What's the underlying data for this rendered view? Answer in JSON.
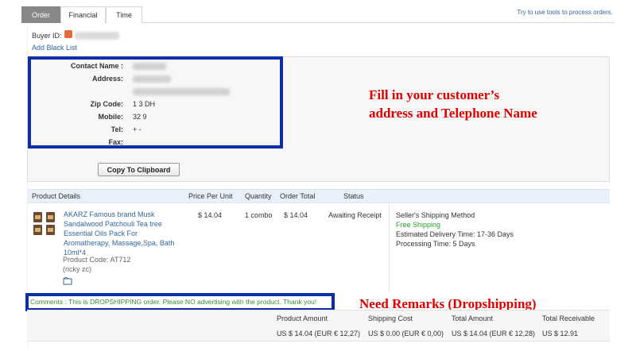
{
  "tabs": [
    {
      "label": "Order",
      "active": true
    },
    {
      "label": "Financial",
      "active": false
    },
    {
      "label": "Time",
      "active": false
    }
  ],
  "tools_link": "Try to use tools to process orders.",
  "buyer": {
    "id_label": "Buyer ID:",
    "add_black_list": "Add Black List"
  },
  "address": {
    "contact_name_label": "Contact Name :",
    "address_label": "Address:",
    "zip_label": "Zip Code:",
    "zip_value": "1 3 DH",
    "mobile_label": "Mobile:",
    "mobile_value": "32 9",
    "tel_label": "Tel:",
    "tel_value": "+ -",
    "fax_label": "Fax:",
    "copy_button": "Copy To Clipboard"
  },
  "annotations": {
    "address_line1": "Fill in your customer’s",
    "address_line2": "address and Telephone Name",
    "remarks": "Need Remarks (Dropshipping)"
  },
  "products": {
    "headers": {
      "details": "Product Details",
      "price": "Price Per Unit",
      "quantity": "Quantity",
      "total": "Order Total",
      "status": "Status"
    },
    "item": {
      "title": "AKARZ Famous brand Musk Sandalwood Patchouli Tea tree Essential Oils Pack For Aromatherapy, Massage,Spa, Bath 10ml*4",
      "code": "Product Code: AT712",
      "variant": "(ricky zc)",
      "price": "$ 14.04",
      "quantity": "1 combo",
      "total": "$ 14.04",
      "status": "Awaiting Receipt"
    },
    "shipping": {
      "method_label": "Seller's Shipping Method",
      "method": "Free Shipping",
      "delivery": "Estimated Delivery Time: 17-36 Days",
      "processing": "Processing Time: 5 Days"
    }
  },
  "comments": "Comments : This is DROPSHIPPING order. Please NO advertising with the product. Thank you!",
  "totals": {
    "product_amount_label": "Product Amount",
    "product_amount": "US $ 14.04 (EUR € 12,27)",
    "shipping_cost_label": "Shipping Cost",
    "shipping_cost": "US $ 0.00 (EUR € 0,00)",
    "total_amount_label": "Total Amount",
    "total_amount": "US $ 14.04 (EUR € 12,28)",
    "total_receivable_label": "Total Receivable",
    "total_receivable": "US $ 12.91"
  },
  "colors": {
    "highlight_box": "#0b2fa6",
    "annotation_text": "#e00000",
    "link": "#336699",
    "comment_text": "#3a8a3a",
    "free_shipping": "#2a9d2a"
  },
  "icons": [
    "attachment-icon",
    "product-thumbnail-icon"
  ]
}
